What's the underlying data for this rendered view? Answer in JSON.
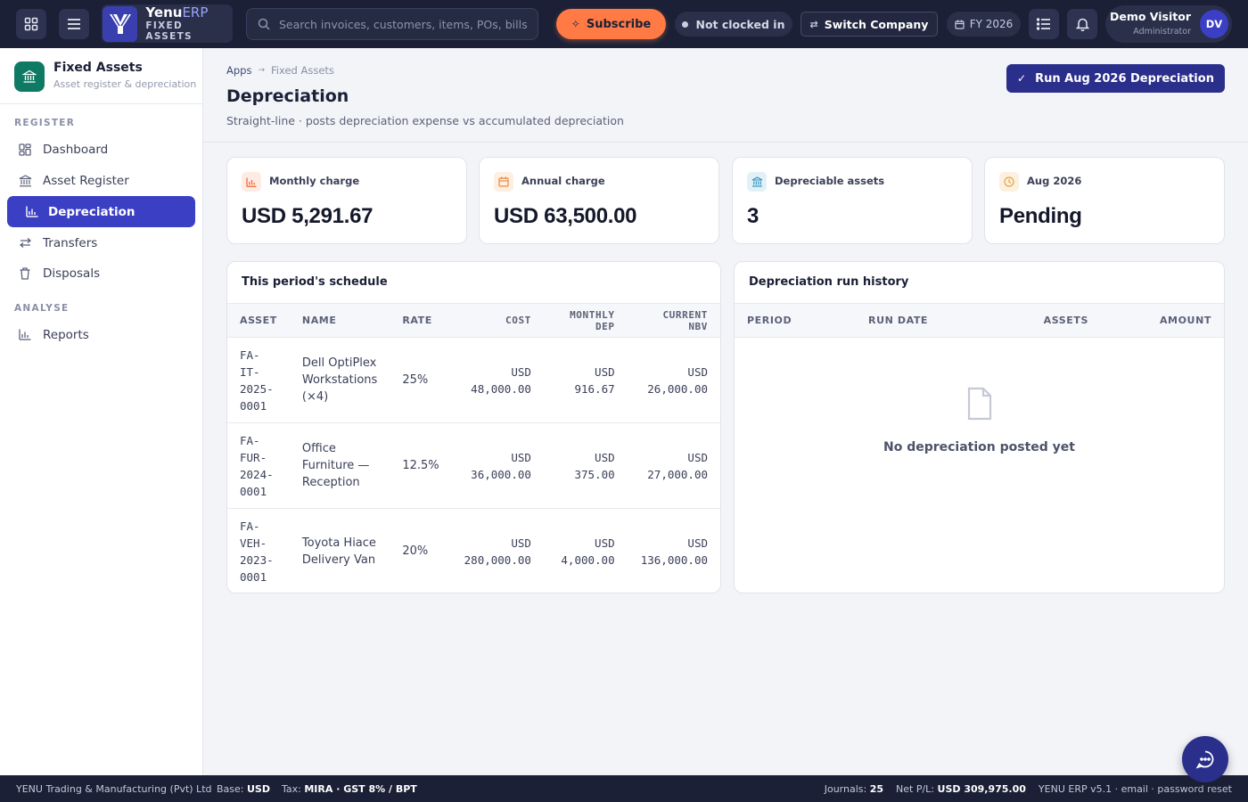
{
  "topbar": {
    "brand_name": "Yenu",
    "brand_name_accent": "ERP",
    "brand_sub": "FIXED ASSETS",
    "search_placeholder": "Search invoices, customers, items, POs, bills…",
    "subscribe_label": "Subscribe",
    "clock_status": "Not clocked in",
    "switch_company_label": "Switch Company",
    "fiscal_year": "FY 2026",
    "user_name": "Demo Visitor",
    "user_role": "Administrator",
    "user_initials": "DV"
  },
  "sidebar": {
    "module_title": "Fixed Assets",
    "module_subtitle": "Asset register & depreciation",
    "section_register": "REGISTER",
    "section_analyse": "ANALYSE",
    "items": [
      {
        "label": "Dashboard",
        "icon": "dashboard-icon"
      },
      {
        "label": "Asset Register",
        "icon": "building-icon"
      },
      {
        "label": "Depreciation",
        "icon": "bar-chart-icon",
        "active": true
      },
      {
        "label": "Transfers",
        "icon": "swap-icon"
      },
      {
        "label": "Disposals",
        "icon": "trash-icon"
      },
      {
        "label": "Reports",
        "icon": "reports-icon"
      }
    ]
  },
  "page": {
    "breadcrumb": [
      "Apps",
      "Fixed Assets"
    ],
    "title": "Depreciation",
    "subtitle": "Straight-line · posts depreciation expense vs accumulated depreciation",
    "run_button_label": "Run Aug 2026 Depreciation"
  },
  "stats": [
    {
      "label": "Monthly charge",
      "value": "USD 5,291.67",
      "icon": "bar-chart-icon",
      "color": "#f26b3a"
    },
    {
      "label": "Annual charge",
      "value": "USD 63,500.00",
      "icon": "calendar-icon",
      "color": "#f08a3c"
    },
    {
      "label": "Depreciable assets",
      "value": "3",
      "icon": "building-icon",
      "color": "#2b8fc0"
    },
    {
      "label": "Aug 2026",
      "value": "Pending",
      "icon": "clock-icon",
      "color": "#e8a33a"
    }
  ],
  "schedule": {
    "title": "This period's schedule",
    "columns": [
      "ASSET",
      "NAME",
      "RATE",
      "COST",
      "MONTHLY DEP",
      "CURRENT NBV"
    ],
    "rows": [
      {
        "asset": [
          "FA-",
          "IT-",
          "2025-",
          "0001"
        ],
        "name": [
          "Dell OptiPlex",
          "Workstations",
          "(×4)"
        ],
        "rate": "25%",
        "cost": [
          "USD",
          "48,000.00"
        ],
        "monthly": [
          "USD",
          "916.67"
        ],
        "nbv": [
          "USD",
          "26,000.00"
        ]
      },
      {
        "asset": [
          "FA-",
          "FUR-",
          "2024-",
          "0001"
        ],
        "name": [
          "Office",
          "Furniture —",
          "Reception"
        ],
        "rate": "12.5%",
        "cost": [
          "USD",
          "36,000.00"
        ],
        "monthly": [
          "USD",
          "375.00"
        ],
        "nbv": [
          "USD",
          "27,000.00"
        ]
      },
      {
        "asset": [
          "FA-",
          "VEH-",
          "2023-",
          "0001"
        ],
        "name": [
          "Toyota Hiace",
          "Delivery Van"
        ],
        "rate": "20%",
        "cost": [
          "USD",
          "280,000.00"
        ],
        "monthly": [
          "USD",
          "4,000.00"
        ],
        "nbv": [
          "USD",
          "136,000.00"
        ]
      }
    ]
  },
  "history": {
    "title": "Depreciation run history",
    "columns": [
      "PERIOD",
      "RUN DATE",
      "ASSETS",
      "AMOUNT"
    ],
    "empty_text": "No depreciation posted yet"
  },
  "footer": {
    "company": "YENU Trading & Manufacturing (Pvt) Ltd",
    "base_label": "Base:",
    "base_value": "USD",
    "tax_label": "Tax:",
    "tax_value": "MIRA · GST 8% / BPT",
    "journals_label": "Journals:",
    "journals_value": "25",
    "pl_label": "Net P/L:",
    "pl_value": "USD 309,975.00",
    "version": "YENU ERP v5.1 · email · password reset"
  }
}
